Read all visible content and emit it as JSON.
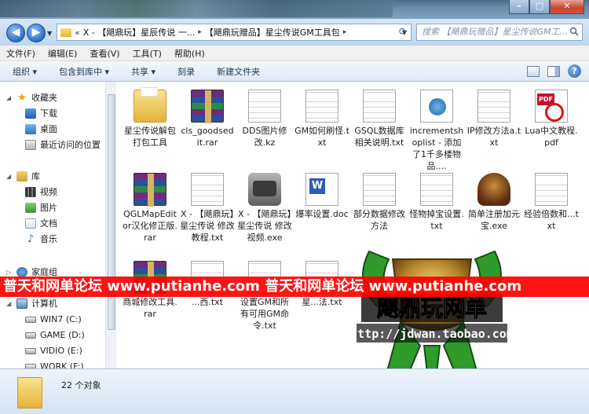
{
  "address": {
    "prefix": "«",
    "crumbs": [
      "X - 【飓鼎玩】星辰传说 一...",
      "【飓鼎玩赠品】星尘传说GM工具包"
    ],
    "search_placeholder": "搜索 【飓鼎玩赠品】星尘传说GM工..."
  },
  "menu": [
    "文件(F)",
    "编辑(E)",
    "查看(V)",
    "工具(T)",
    "帮助(H)"
  ],
  "toolbar": [
    "组织 ▾",
    "包含到库中 ▾",
    "共享 ▾",
    "刻录",
    "新建文件夹"
  ],
  "nav": {
    "favorites": "收藏夹",
    "downloads": "下载",
    "desktop": "桌面",
    "recent": "最近访问的位置",
    "libraries": "库",
    "videos": "视频",
    "pictures": "图片",
    "documents": "文档",
    "music": "音乐",
    "homegroup": "家庭组",
    "computer": "计算机",
    "drives": [
      "WIN7 (C:)",
      "GAME (D:)",
      "VIDIO (E:)",
      "WORK (F:)"
    ]
  },
  "files": [
    {
      "name": "星尘传说解包打包工具",
      "kind": "folder"
    },
    {
      "name": "cls_goodsedit.rar",
      "kind": "rar"
    },
    {
      "name": "DDS图片修改.kz",
      "kind": "txt"
    },
    {
      "name": "GM如何刷怪.txt",
      "kind": "txt"
    },
    {
      "name": "GSQL数据库相关说明.txt",
      "kind": "txt"
    },
    {
      "name": "incrementshoplist - 添加了1千多楼物品....",
      "kind": "web"
    },
    {
      "name": "IP修改方法a.txt",
      "kind": "txt"
    },
    {
      "name": "Lua中文教程.pdf",
      "kind": "pdf"
    },
    {
      "name": "QGLMapEditor汉化修正版.rar",
      "kind": "rar"
    },
    {
      "name": "X - 【飓鼎玩】星尘传说 修改教程.txt",
      "kind": "txt"
    },
    {
      "name": "X - 【飓鼎玩】星尘传说 修改视频.exe",
      "kind": "exe"
    },
    {
      "name": "爆率设置.doc",
      "kind": "word"
    },
    {
      "name": "部分数据修改方法",
      "kind": "txt"
    },
    {
      "name": "怪物掉宝设置.txt",
      "kind": "txt"
    },
    {
      "name": "简单注册加元宝.exe",
      "kind": "game"
    },
    {
      "name": "经验倍数和...txt",
      "kind": "txt"
    },
    {
      "name": "商城修改工具.rar",
      "kind": "rar"
    },
    {
      "name": "...西.txt",
      "kind": "txt"
    },
    {
      "name": "设置GM和所有可用GM命令.txt",
      "kind": "txt"
    },
    {
      "name": "星...法.txt",
      "kind": "txt"
    }
  ],
  "status": {
    "count": "22 个对象"
  },
  "watermark": {
    "banner": "普天和网单论坛 www.putianhe.com 普天和网单论坛 www.putianhe.com",
    "logo_text": "飓鼎玩网单",
    "logo_url": "http://jdwan.taobao.com"
  },
  "colors": {
    "banner_red": "#ff0000",
    "logo_green": "#3fae2a",
    "logo_gold": "#c9a43a"
  }
}
